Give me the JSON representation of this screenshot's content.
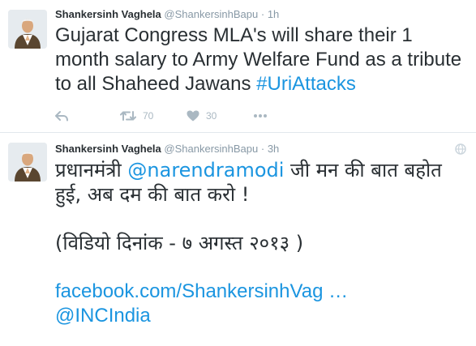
{
  "tweets": [
    {
      "fullname": "Shankersinh Vaghela",
      "handle": "@ShankersinhBapu",
      "separator": "·",
      "time": "1h",
      "text_plain": "Gujarat Congress MLA's will share their 1 month salary to Army Welfare Fund as a tribute to all Shaheed Jawans ",
      "hashtag": "#UriAttacks",
      "retweet_count": "70",
      "like_count": "30",
      "icons": [
        "reply-icon",
        "retweet-icon",
        "heart-icon",
        "more-icon"
      ]
    },
    {
      "fullname": "Shankersinh Vaghela",
      "handle": "@ShankersinhBapu",
      "separator": "·",
      "time": "3h",
      "text_prefix": "प्रधानमंत्री ",
      "mention": "@narendramodi",
      "text_rest": " जी मन की बात बहोत हुई, अब दम की बात करो !",
      "date_note": "(विडियो दिनांक - ७ अगस्त २०१३ )",
      "link": "facebook.com/ShankersinhVag …",
      "mention2": "@INCIndia",
      "icons": [
        "globe-icon"
      ]
    }
  ],
  "colors": {
    "link": "#1b95e0",
    "meta": "#8899a6",
    "icon": "#aab8c2",
    "text": "#292f33"
  }
}
